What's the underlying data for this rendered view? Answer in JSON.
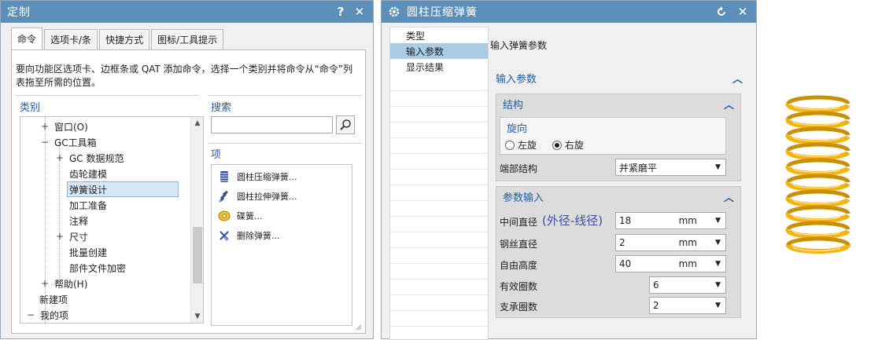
{
  "customize_dialog": {
    "title": "定制",
    "help_button": "?",
    "close_button": "✕",
    "tabs": [
      "命令",
      "选项卡/条",
      "快捷方式",
      "图标/工具提示"
    ],
    "description": "要向功能区选项卡、边框条或 QAT 添加命令，选择一个类别并将命令从“命令”列表拖至所需的位置。",
    "category_label": "类别",
    "search_label": "搜索",
    "items_label": "项",
    "tree": [
      {
        "label": "窗口(O)",
        "expander": "+"
      },
      {
        "label": "GC工具箱",
        "expander": "−"
      },
      {
        "label": "GC 数据规范",
        "expander": "+"
      },
      {
        "label": "齿轮建模",
        "expander": ""
      },
      {
        "label": "弹簧设计",
        "expander": ""
      },
      {
        "label": "加工准备",
        "expander": ""
      },
      {
        "label": "注释",
        "expander": ""
      },
      {
        "label": "尺寸",
        "expander": "+"
      },
      {
        "label": "批量创建",
        "expander": ""
      },
      {
        "label": "部件文件加密",
        "expander": ""
      },
      {
        "label": "帮助(H)",
        "expander": "+"
      },
      {
        "label": "新建项",
        "expander": ""
      },
      {
        "label": "我的项",
        "expander": "−"
      }
    ],
    "items": [
      "圆柱压缩弹簧...",
      "圆柱拉伸弹簧...",
      "碟簧...",
      "删除弹簧..."
    ],
    "search_value": ""
  },
  "spring_dialog": {
    "title": "圆柱压缩弹簧",
    "nav": [
      "类型",
      "输入参数",
      "显示结果"
    ],
    "pane_title": "输入弹簧参数",
    "group_title": "输入参数",
    "structure": {
      "title": "结构",
      "rotation_title": "旋向",
      "options": [
        "左旋",
        "右旋"
      ],
      "selected": "右旋",
      "end_label": "端部结构",
      "end_value": "并紧磨平"
    },
    "params": {
      "title": "参数输入",
      "rows": [
        {
          "label": "中间直径",
          "value": "18",
          "unit": "mm"
        },
        {
          "label": "钢丝直径",
          "value": "2",
          "unit": "mm"
        },
        {
          "label": "自由高度",
          "value": "40",
          "unit": "mm"
        },
        {
          "label": "有效圈数",
          "value": "6",
          "unit": ""
        },
        {
          "label": "支承圈数",
          "value": "2",
          "unit": ""
        }
      ],
      "annotation": "(外径-线径)"
    },
    "accent_color": "#5b8fb9"
  },
  "preview": {
    "spring_color": "#f5b40b",
    "coils": 10
  }
}
